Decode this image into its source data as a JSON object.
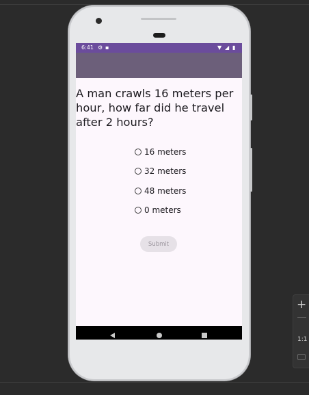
{
  "status_bar": {
    "time": "6:41",
    "icons": [
      "settings-icon",
      "sd-card-icon",
      "wifi-icon",
      "signal-icon",
      "battery-icon"
    ]
  },
  "quiz": {
    "question": "A man crawls 16 meters per hour, how far did he travel after 2 hours?",
    "options": [
      "16 meters",
      "32 meters",
      "48 meters",
      "0 meters"
    ],
    "submit_label": "Submit"
  },
  "nav_bar": {
    "icons": [
      "back-icon",
      "home-icon",
      "recents-icon"
    ]
  },
  "zoom_panel": {
    "ratio_label": "1:1"
  },
  "colors": {
    "status_bar": "#6b4c9c",
    "app_bar": "#6c5f7a",
    "screen_background": "#fdf7fd",
    "ide_background": "#2b2b2b"
  }
}
